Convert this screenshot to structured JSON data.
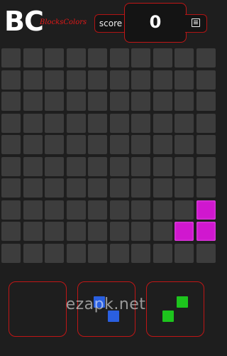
{
  "header": {
    "logo_text": "BC",
    "logo_subtitle": "BlocksColors",
    "score_label": "score",
    "score_value": "0",
    "menu_icon": "menu-icon"
  },
  "board": {
    "rows": 10,
    "cols": 10,
    "empty_color": "#3d3d3d",
    "filled_cells": [
      {
        "row": 7,
        "col": 9,
        "color": "#d017cf"
      },
      {
        "row": 8,
        "col": 8,
        "color": "#d017cf"
      },
      {
        "row": 8,
        "col": 9,
        "color": "#d017cf"
      }
    ]
  },
  "tray": {
    "slots": [
      {
        "name": "slot-1",
        "cells": []
      },
      {
        "name": "slot-2",
        "color": "#2a5fe0",
        "cells": [
          {
            "row": 0,
            "col": 0
          },
          {
            "row": 1,
            "col": 1
          }
        ]
      },
      {
        "name": "slot-3",
        "color": "#1dc41d",
        "cells": [
          {
            "row": 0,
            "col": 1
          },
          {
            "row": 1,
            "col": 0
          }
        ]
      }
    ]
  },
  "watermark": "ezapk.net",
  "colors": {
    "accent_border": "#c01616",
    "background": "#1e1e1e"
  }
}
